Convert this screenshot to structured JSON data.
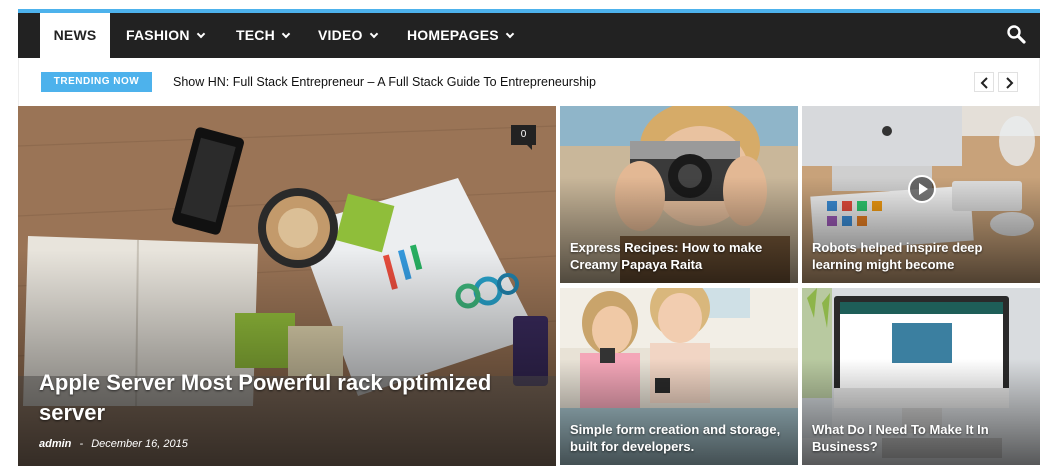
{
  "nav": {
    "items": [
      {
        "label": "NEWS",
        "active": true,
        "has_dropdown": false
      },
      {
        "label": "FASHION",
        "active": false,
        "has_dropdown": true
      },
      {
        "label": "TECH",
        "active": false,
        "has_dropdown": true
      },
      {
        "label": "VIDEO",
        "active": false,
        "has_dropdown": true
      },
      {
        "label": "HOMEPAGES",
        "active": false,
        "has_dropdown": true
      }
    ],
    "search_icon": "search-icon"
  },
  "trending": {
    "badge": "TRENDING NOW",
    "title": "Show HN: Full Stack Entrepreneur – A Full Stack Guide To Entrepreneurship",
    "prev_icon": "chevron-left-icon",
    "next_icon": "chevron-right-icon"
  },
  "featured": {
    "title": "Apple Server Most Powerful rack optimized server",
    "author": "admin",
    "separator": "-",
    "date": "December 16, 2015",
    "comments": "0"
  },
  "tiles": [
    {
      "title": "Express Recipes: How to make Creamy Papaya Raita"
    },
    {
      "title": "Robots helped inspire deep learning might become",
      "video": true
    },
    {
      "title": "Simple form creation and storage, built for developers."
    },
    {
      "title": "What Do I Need To Make It In Business?"
    }
  ],
  "colors": {
    "accent": "#4db2ec",
    "navbar": "#222222"
  }
}
